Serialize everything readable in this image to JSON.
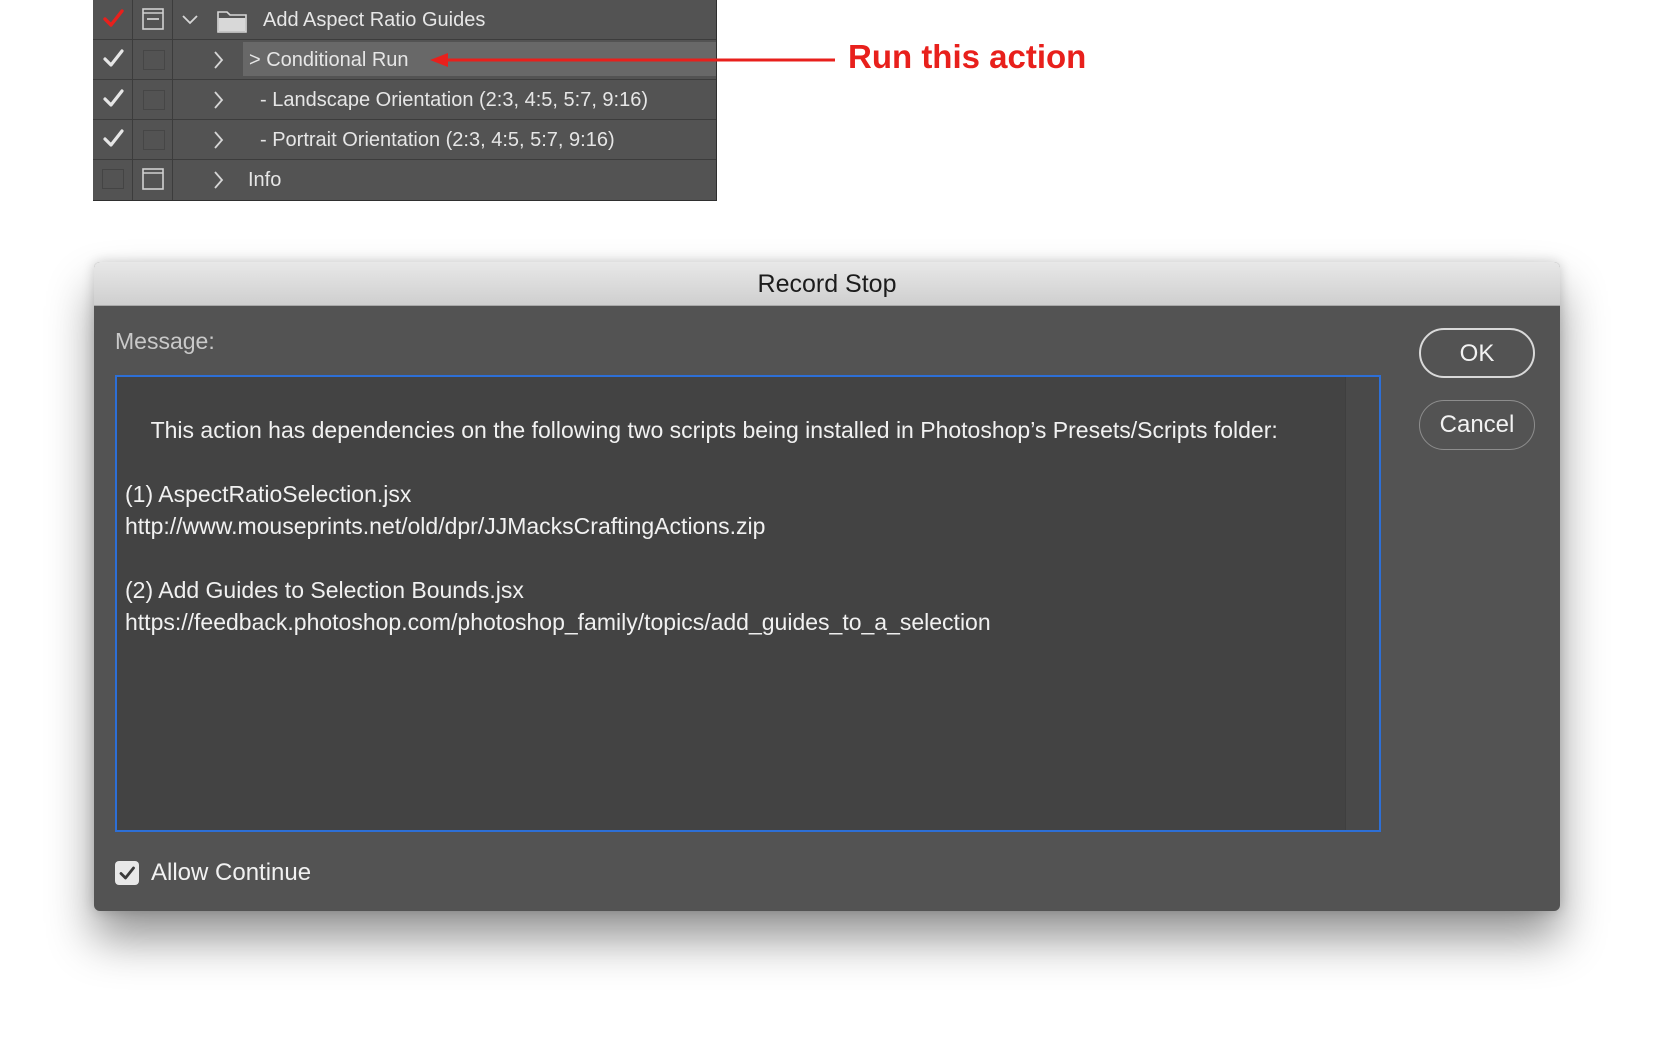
{
  "actions_panel": {
    "rows": [
      {
        "label": "Add Aspect Ratio Guides",
        "checked": true,
        "check_color": "#e8201c",
        "dialog_icon": "dialog-toggle-partial-icon",
        "expander": "chevron-down-icon",
        "type_icon": "folder-icon"
      },
      {
        "label": "> Conditional Run",
        "checked": true,
        "check_color": "#e6e6e6",
        "dialog_icon": "empty",
        "expander": "chevron-right-icon",
        "highlighted": true
      },
      {
        "label": "- Landscape Orientation (2:3, 4:5, 5:7, 9:16)",
        "checked": true,
        "check_color": "#e6e6e6",
        "dialog_icon": "empty",
        "expander": "chevron-right-icon"
      },
      {
        "label": "- Portrait Orientation (2:3, 4:5, 5:7, 9:16)",
        "checked": true,
        "check_color": "#e6e6e6",
        "dialog_icon": "empty",
        "expander": "chevron-right-icon"
      },
      {
        "label": "Info",
        "checked": false,
        "dialog_icon": "dialog-toggle-icon",
        "expander": "chevron-right-icon"
      }
    ]
  },
  "annotation": {
    "text": "Run this action",
    "color": "#e8201c"
  },
  "dialog": {
    "title": "Record Stop",
    "message_label": "Message:",
    "message_text": "This action has dependencies on the following two scripts being installed in Photoshop’s Presets/Scripts folder:\n\n(1) AspectRatioSelection.jsx\nhttp://www.mouseprints.net/old/dpr/JJMacksCraftingActions.zip\n\n(2) Add Guides to Selection Bounds.jsx\nhttps://feedback.photoshop.com/photoshop_family/topics/add_guides_to_a_selection",
    "ok_label": "OK",
    "cancel_label": "Cancel",
    "allow_continue_label": "Allow Continue",
    "allow_continue_checked": true,
    "focus_color": "#2d6fd6"
  }
}
